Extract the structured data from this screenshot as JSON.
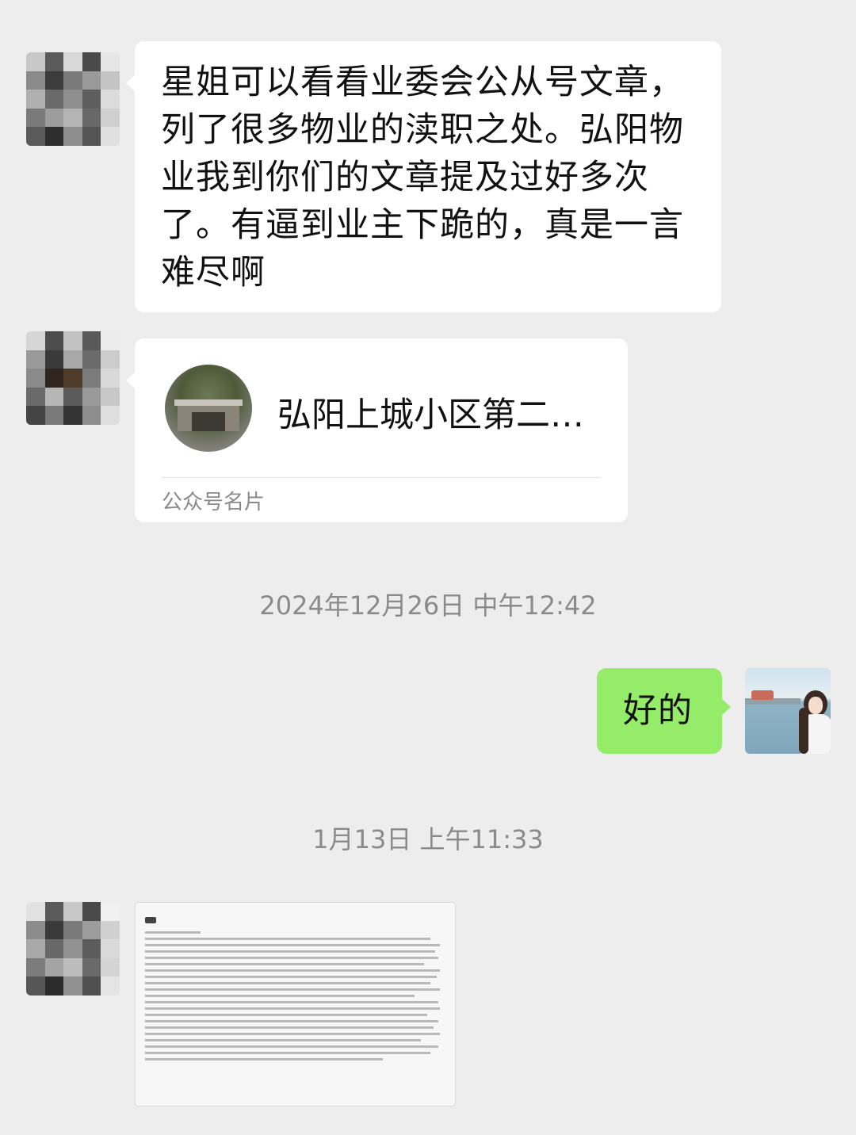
{
  "messages": {
    "m1": {
      "text": "星姐可以看看业委会公从号文章，列了很多物业的渎职之处。弘阳物业我到你们的文章提及过好多次了。有逼到业主下跪的，真是一言难尽啊"
    },
    "card": {
      "title": "弘阳上城小区第二…",
      "footer": "公众号名片"
    },
    "ts1": "2024年12月26日 中午12:42",
    "m2": {
      "text": "好的"
    },
    "ts2": "1月13日 上午11:33"
  },
  "colors": {
    "background": "#ededed",
    "bubble_incoming": "#ffffff",
    "bubble_outgoing": "#95ec69"
  },
  "icons": [
    "avatar-contact",
    "avatar-self",
    "account-logo",
    "document-image"
  ]
}
